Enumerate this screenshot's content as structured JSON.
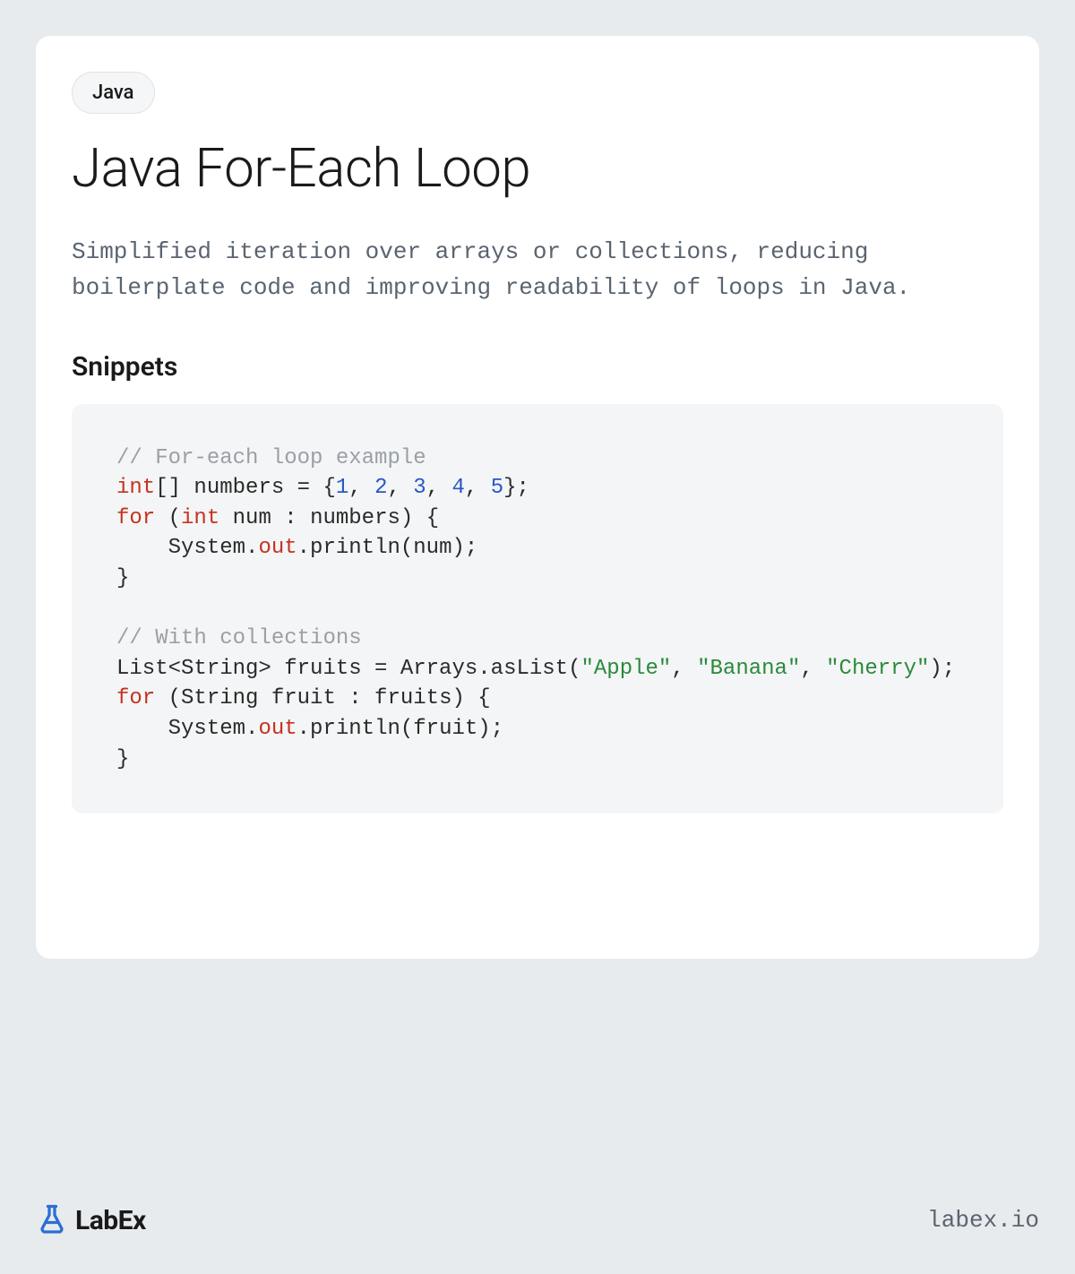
{
  "tag": "Java",
  "title": "Java For-Each Loop",
  "description": "Simplified iteration over arrays or collections, reducing boilerplate code and improving readability of loops in Java.",
  "section_heading": "Snippets",
  "code": {
    "tokens": [
      {
        "t": "comment",
        "v": "// For-each loop example"
      },
      {
        "t": "nl"
      },
      {
        "t": "keyword",
        "v": "int"
      },
      {
        "t": "plain",
        "v": "[] numbers = {"
      },
      {
        "t": "number",
        "v": "1"
      },
      {
        "t": "plain",
        "v": ", "
      },
      {
        "t": "number",
        "v": "2"
      },
      {
        "t": "plain",
        "v": ", "
      },
      {
        "t": "number",
        "v": "3"
      },
      {
        "t": "plain",
        "v": ", "
      },
      {
        "t": "number",
        "v": "4"
      },
      {
        "t": "plain",
        "v": ", "
      },
      {
        "t": "number",
        "v": "5"
      },
      {
        "t": "plain",
        "v": "};"
      },
      {
        "t": "nl"
      },
      {
        "t": "keyword",
        "v": "for"
      },
      {
        "t": "plain",
        "v": " ("
      },
      {
        "t": "keyword",
        "v": "int"
      },
      {
        "t": "plain",
        "v": " num : numbers) {"
      },
      {
        "t": "nl"
      },
      {
        "t": "plain",
        "v": "    System."
      },
      {
        "t": "field",
        "v": "out"
      },
      {
        "t": "plain",
        "v": ".println(num);"
      },
      {
        "t": "nl"
      },
      {
        "t": "plain",
        "v": "}"
      },
      {
        "t": "nl"
      },
      {
        "t": "nl"
      },
      {
        "t": "comment",
        "v": "// With collections"
      },
      {
        "t": "nl"
      },
      {
        "t": "plain",
        "v": "List<String> fruits = Arrays.asList("
      },
      {
        "t": "string",
        "v": "\"Apple\""
      },
      {
        "t": "plain",
        "v": ", "
      },
      {
        "t": "string",
        "v": "\"Banana\""
      },
      {
        "t": "plain",
        "v": ", "
      },
      {
        "t": "string",
        "v": "\"Cherry\""
      },
      {
        "t": "plain",
        "v": ");"
      },
      {
        "t": "nl"
      },
      {
        "t": "keyword",
        "v": "for"
      },
      {
        "t": "plain",
        "v": " (String fruit : fruits) {"
      },
      {
        "t": "nl"
      },
      {
        "t": "plain",
        "v": "    System."
      },
      {
        "t": "field",
        "v": "out"
      },
      {
        "t": "plain",
        "v": ".println(fruit);"
      },
      {
        "t": "nl"
      },
      {
        "t": "plain",
        "v": "}"
      }
    ]
  },
  "brand": "LabEx",
  "url": "labex.io"
}
